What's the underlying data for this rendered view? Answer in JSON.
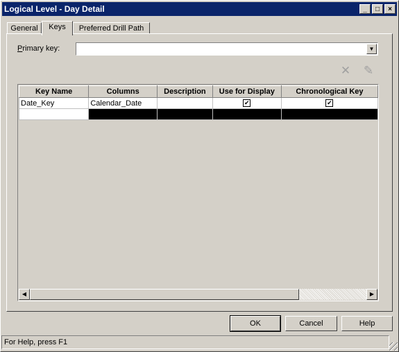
{
  "window": {
    "title": "Logical Level - Day Detail",
    "controls": {
      "minimize": "_",
      "maximize": "□",
      "close": "×"
    }
  },
  "tabs": [
    {
      "label": "General"
    },
    {
      "label": "Keys",
      "active": true
    },
    {
      "label": "Preferred Drill Path"
    }
  ],
  "primary_key": {
    "label": "Primary key:",
    "value": ""
  },
  "toolbar": {
    "delete_icon": "delete-icon",
    "edit_icon": "pencil-icon"
  },
  "keys_table": {
    "headers": [
      "Key Name",
      "Columns",
      "Description",
      "Use for Display",
      "Chronological Key"
    ],
    "rows": [
      {
        "key_name": "Date_Key",
        "columns": "Calendar_Date",
        "description": "",
        "use_for_display": true,
        "chronological_key": true
      }
    ]
  },
  "buttons": {
    "ok": "OK",
    "cancel": "Cancel",
    "help": "Help"
  },
  "status": {
    "text": "For Help, press F1"
  }
}
